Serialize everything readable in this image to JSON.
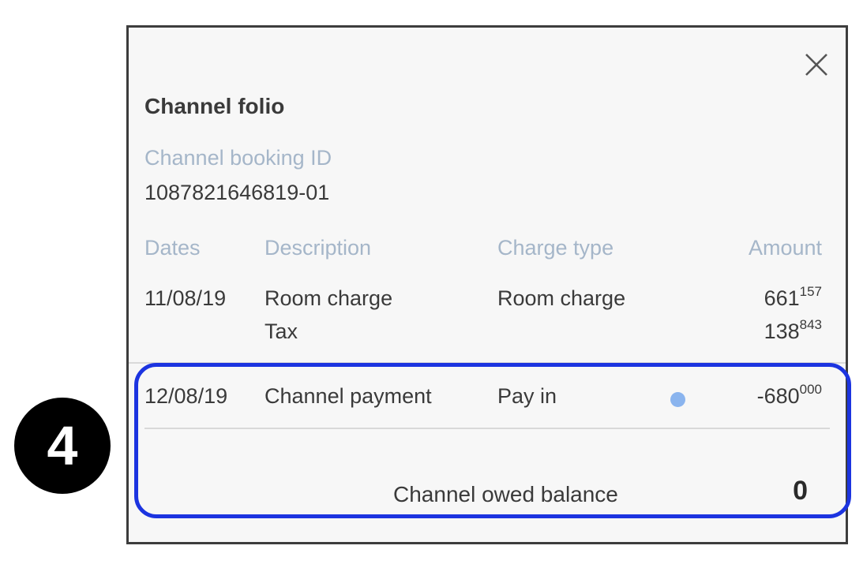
{
  "step_badge": "4",
  "dialog": {
    "title": "Channel folio",
    "close_icon": "close-icon",
    "booking": {
      "label": "Channel booking ID",
      "value": "1087821646819-01"
    },
    "columns": {
      "dates": "Dates",
      "description": "Description",
      "charge_type": "Charge type",
      "amount": "Amount"
    },
    "rows": [
      {
        "date": "11/08/19",
        "lines": [
          {
            "description": "Room charge",
            "charge_type": "Room charge",
            "amount_main": "661",
            "amount_sup": "157"
          },
          {
            "description": "Tax",
            "charge_type": "",
            "amount_main": "138",
            "amount_sup": "843"
          }
        ]
      },
      {
        "date": "12/08/19",
        "lines": [
          {
            "description": "Channel payment",
            "charge_type": "Pay in",
            "status_dot": "blue-dot",
            "amount_main": "-680",
            "amount_sup": "000"
          }
        ]
      }
    ],
    "balance": {
      "label": "Channel owed balance",
      "value": "0"
    }
  },
  "colors": {
    "highlight_border": "#1c34e0",
    "status_dot": "#8ab4ee",
    "muted_label": "#a5b6c9",
    "badge_bg": "#000000"
  }
}
